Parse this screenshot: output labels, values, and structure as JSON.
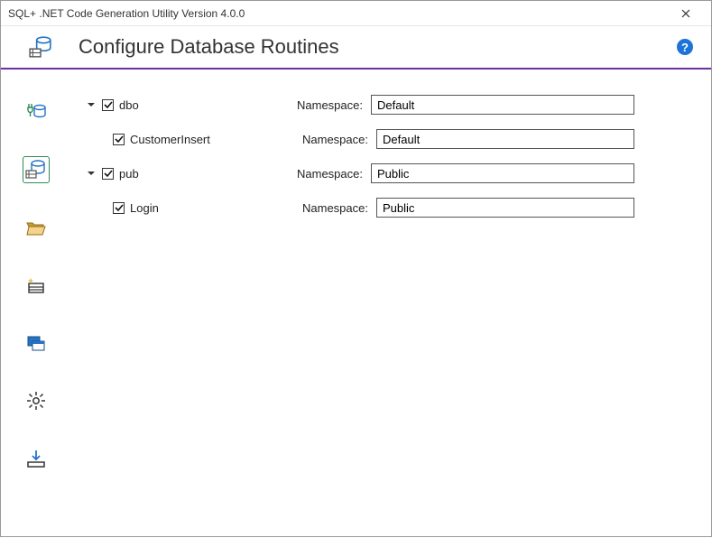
{
  "window": {
    "title": "SQL+ .NET Code Generation Utility Version 4.0.0"
  },
  "header": {
    "title": "Configure Database Routines",
    "help_glyph": "?"
  },
  "namespace_label": "Namespace:",
  "tree": [
    {
      "schema": "dbo",
      "checked": true,
      "expanded": true,
      "namespace": "Default",
      "routines": [
        {
          "name": "CustomerInsert",
          "checked": true,
          "namespace": "Default"
        }
      ]
    },
    {
      "schema": "pub",
      "checked": true,
      "expanded": true,
      "namespace": "Public",
      "routines": [
        {
          "name": "Login",
          "checked": true,
          "namespace": "Public"
        }
      ]
    }
  ],
  "sidebar": {
    "items": [
      {
        "id": "connect",
        "active": false
      },
      {
        "id": "routines",
        "active": true
      },
      {
        "id": "folder",
        "active": false
      },
      {
        "id": "options",
        "active": false
      },
      {
        "id": "build",
        "active": false
      },
      {
        "id": "settings",
        "active": false
      },
      {
        "id": "download",
        "active": false
      }
    ]
  }
}
